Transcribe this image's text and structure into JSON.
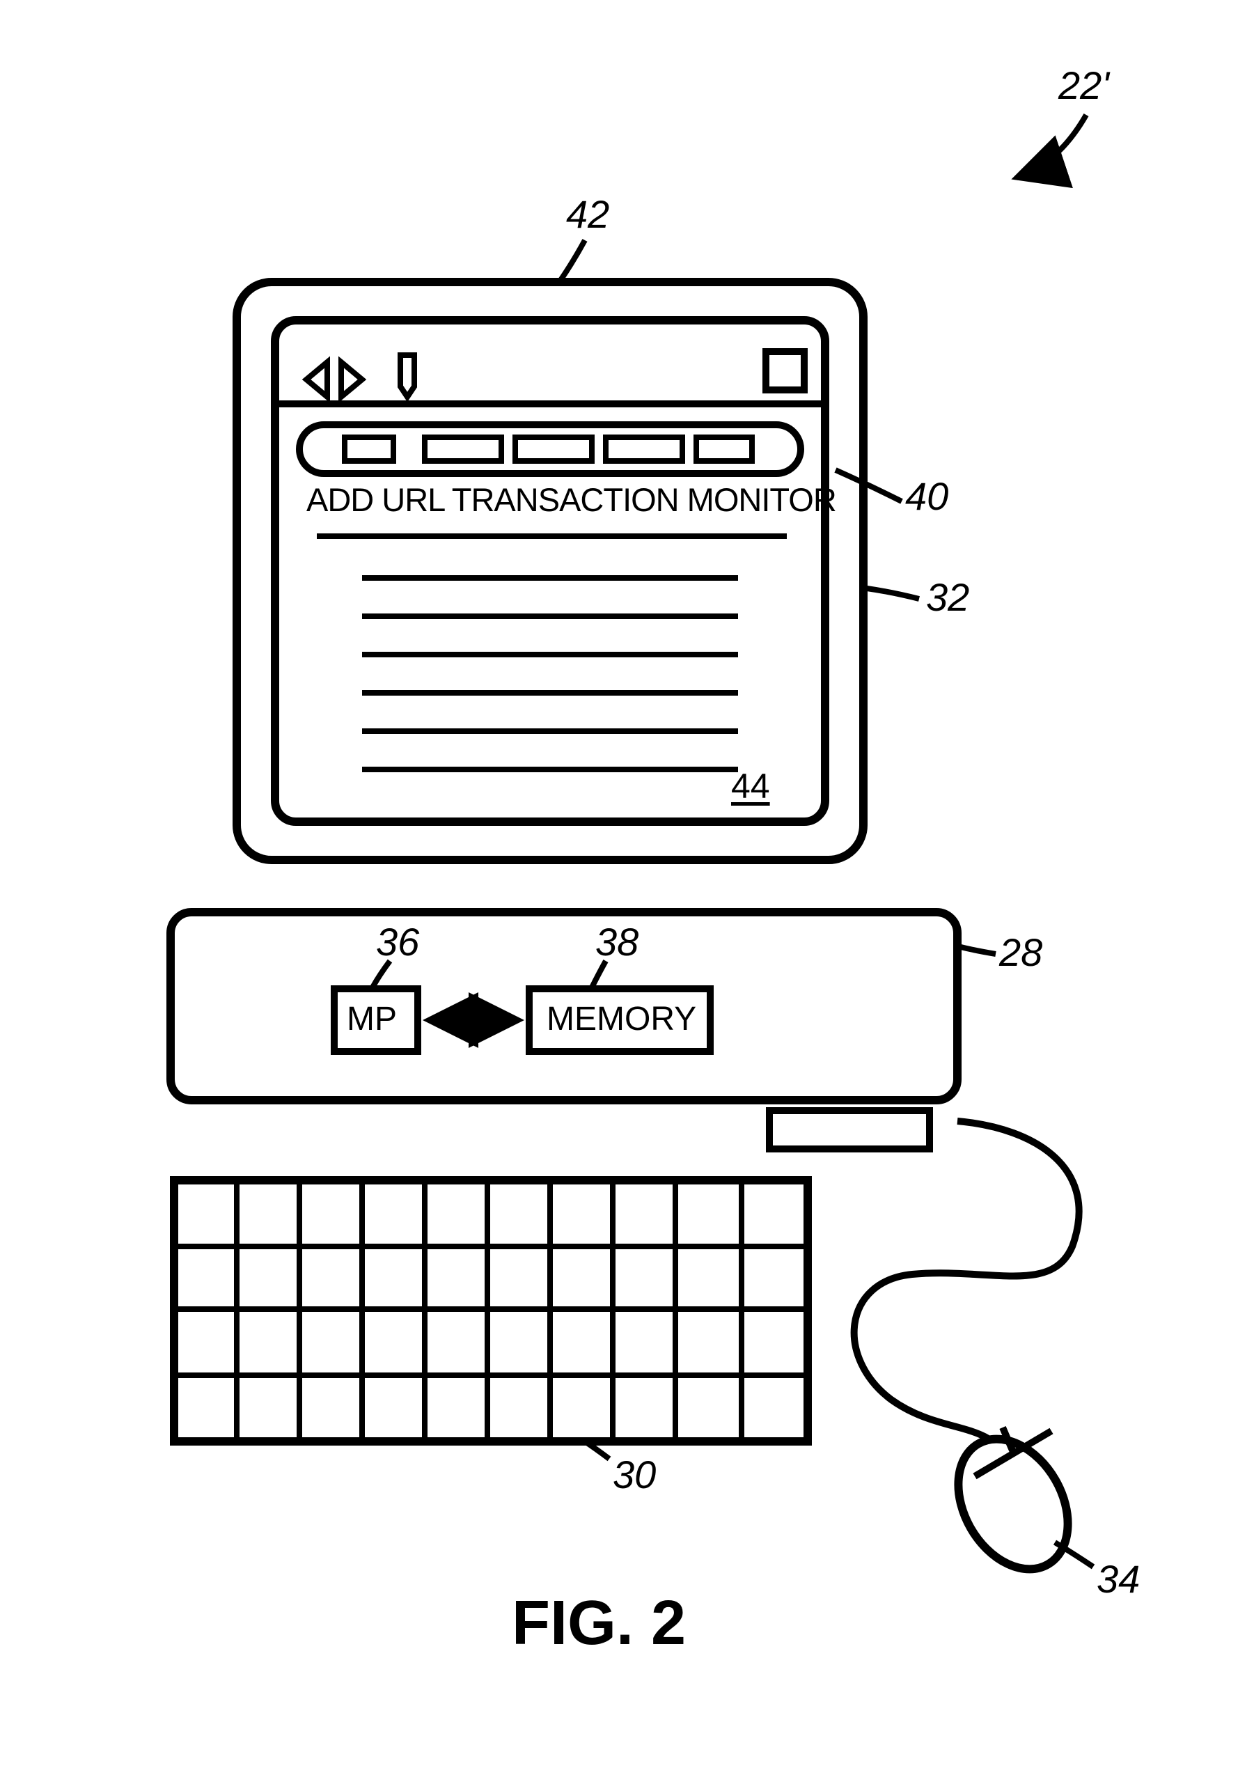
{
  "labels": {
    "topRef": "22'",
    "ref42": "42",
    "ref40": "40",
    "ref32": "32",
    "ref44": "44",
    "ref36": "36",
    "ref38": "38",
    "ref28": "28",
    "ref30": "30",
    "ref34": "34",
    "mp": "MP",
    "memory": "MEMORY",
    "windowTitle": "ADD URL TRANSACTION MONITOR",
    "figTitle": "FIG. 2"
  }
}
